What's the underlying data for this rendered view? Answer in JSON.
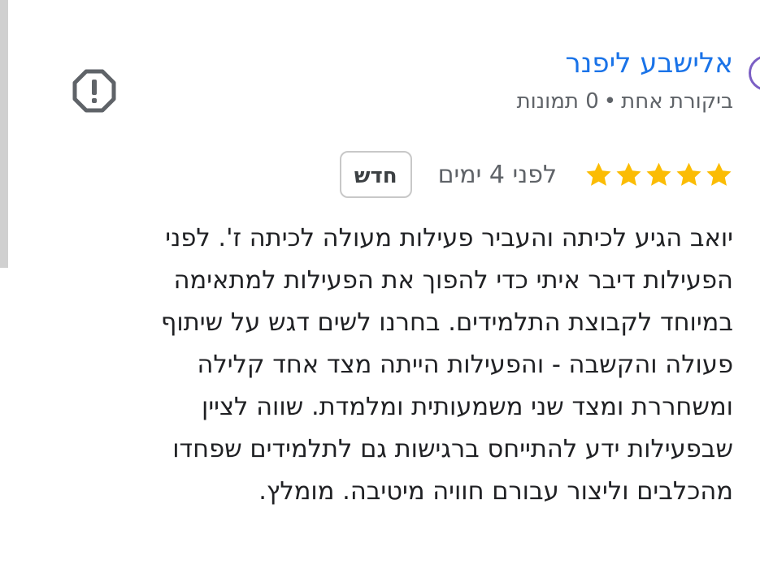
{
  "review": {
    "author_name": "אלישבע ליפנר",
    "review_count": "ביקורת אחת",
    "separator": "•",
    "photo_count": "0 תמונות",
    "rating": 5,
    "max_rating": 5,
    "time_ago": "לפני 4 ימים",
    "new_badge": "חדש",
    "text_lines": [
      "יואב הגיע לכיתה והעביר פעילות מעולה לכיתה ז'. לפני",
      "הפעילות דיבר איתי כדי להפוך את הפעילות למתאימה",
      "במיוחד לקבוצת התלמידים. בחרנו לשים דגש על שיתוף",
      "פעולה והקשבה - והפעילות הייתה מצד אחד קלילה",
      "ומשחררת ומצד שני משמעותית ומלמדת. שווה לציין",
      "שבפעילות ידע להתייחס ברגישות גם לתלמידים שפחדו",
      "מהכלבים וליצור עבורם חוויה מיטיבה. מומלץ."
    ]
  },
  "icons": {
    "report": "report-icon",
    "star": "star-icon"
  },
  "colors": {
    "author_link": "#1a73e8",
    "star": "#fbbc04",
    "meta_text": "#5f6368",
    "body_text": "#202124",
    "icon": "#5f6368"
  }
}
